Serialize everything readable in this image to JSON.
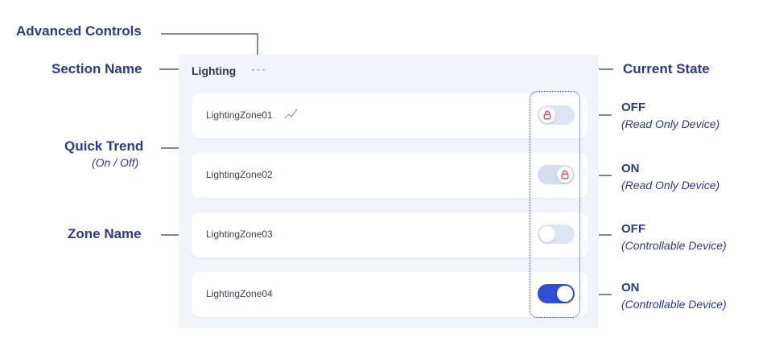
{
  "callouts": {
    "advanced_controls": "Advanced Controls",
    "section_name": "Section Name",
    "quick_trend": "Quick Trend",
    "quick_trend_sub": "(On / Off)",
    "zone_name": "Zone Name",
    "current_state": "Current State"
  },
  "section": {
    "title": "Lighting"
  },
  "zones": [
    {
      "name": "LightingZone01",
      "state": "OFF",
      "device_type": "(Read Only Device)"
    },
    {
      "name": "LightingZone02",
      "state": "ON",
      "device_type": "(Read Only Device)"
    },
    {
      "name": "LightingZone03",
      "state": "OFF",
      "device_type": "(Controllable Device)"
    },
    {
      "name": "LightingZone04",
      "state": "ON",
      "device_type": "(Controllable Device)"
    }
  ],
  "icons": {
    "advanced": "more-dots-icon",
    "trend": "trend-line-icon",
    "lock": "lock-icon"
  },
  "colors": {
    "annotation": "#2d3a8c",
    "toggle_on": "#2f4ed4",
    "lock": "#e0435a"
  }
}
